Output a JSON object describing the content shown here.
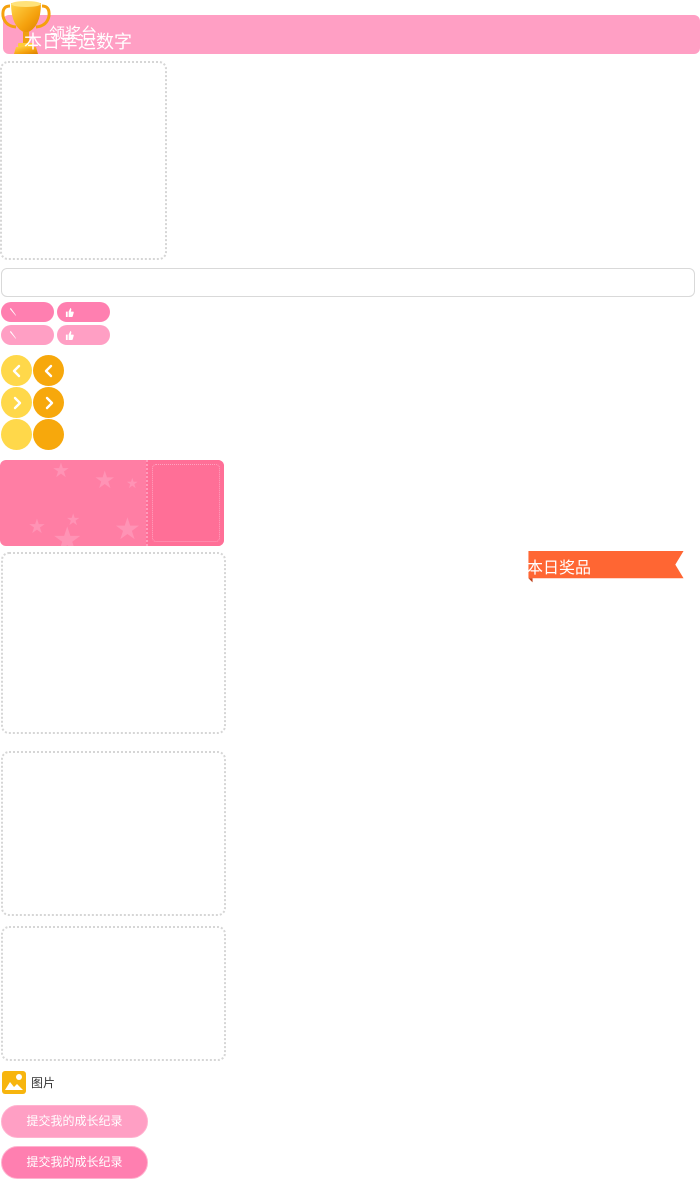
{
  "header": {
    "title": "领奖台",
    "bar_color": "#ff9fc4",
    "icon": "trophy-icon"
  },
  "pills": [
    {
      "icon": "pencil-icon",
      "color": "#ff7fb0"
    },
    {
      "icon": "thumbs-up-icon",
      "color": "#ff7fb0"
    },
    {
      "icon": "pencil-icon",
      "color": "#ff9fc4"
    },
    {
      "icon": "thumbs-up-icon",
      "color": "#ff9fc4"
    }
  ],
  "nav_circles": [
    {
      "icon": "chevron-left-icon",
      "color": "#ffd84a"
    },
    {
      "icon": "chevron-left-icon",
      "color": "#f7a80c"
    },
    {
      "icon": "chevron-right-icon",
      "color": "#ffd84a"
    },
    {
      "icon": "chevron-right-icon",
      "color": "#f7a80c"
    },
    {
      "icon": "",
      "color": "#ffd84a"
    },
    {
      "icon": "",
      "color": "#f7a80c"
    }
  ],
  "lucky": {
    "label": "本日幸运数字",
    "color": "#ff7ea4"
  },
  "prize": {
    "label": "本日奖品",
    "color": "#ff6633"
  },
  "attachment": {
    "label": "图片",
    "icon": "image-icon"
  },
  "submit": {
    "label_1": "提交我的成长纪录",
    "label_2": "提交我的成长纪录"
  }
}
